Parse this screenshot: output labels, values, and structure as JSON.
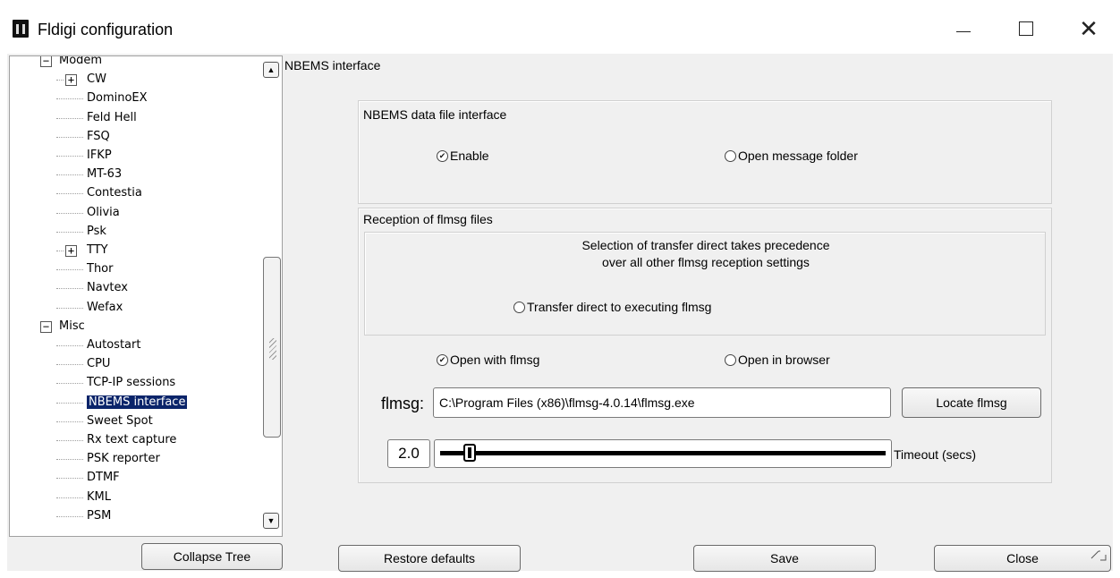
{
  "window": {
    "title": "Fldigi configuration",
    "controls": {
      "minimize": "minimize-icon",
      "maximize": "maximize-icon",
      "close": "close-icon"
    }
  },
  "tree": {
    "items": [
      {
        "label": "Modem",
        "toggle": "−"
      },
      {
        "label": "CW",
        "toggle": "+"
      },
      {
        "label": "DominoEX"
      },
      {
        "label": "Feld Hell"
      },
      {
        "label": "FSQ"
      },
      {
        "label": "IFKP"
      },
      {
        "label": "MT-63"
      },
      {
        "label": "Contestia"
      },
      {
        "label": "Olivia"
      },
      {
        "label": "Psk"
      },
      {
        "label": "TTY",
        "toggle": "+"
      },
      {
        "label": "Thor"
      },
      {
        "label": "Navtex"
      },
      {
        "label": "Wefax"
      },
      {
        "label": "Misc",
        "toggle": "−"
      },
      {
        "label": "Autostart"
      },
      {
        "label": "CPU"
      },
      {
        "label": "TCP-IP sessions"
      },
      {
        "label": "NBEMS interface",
        "selected": true
      },
      {
        "label": "Sweet Spot"
      },
      {
        "label": "Rx text capture"
      },
      {
        "label": "PSK reporter"
      },
      {
        "label": "DTMF"
      },
      {
        "label": "KML"
      },
      {
        "label": "PSM"
      }
    ],
    "scroll_up_icon": "▲",
    "scroll_down_icon": "▼"
  },
  "panel": {
    "title": "NBEMS interface",
    "data_file": {
      "label": "NBEMS data file interface",
      "enable": {
        "label": "Enable",
        "checked": true
      },
      "open_folder": {
        "label": "Open message folder",
        "checked": false
      }
    },
    "reception": {
      "label": "Reception of flmsg files",
      "note_line1": "Selection of transfer direct takes precedence",
      "note_line2": "over all other flmsg reception settings",
      "transfer_direct": {
        "label": "Transfer direct to executing flmsg",
        "checked": false
      },
      "open_with": {
        "label": "Open with flmsg",
        "checked": true
      },
      "open_browser": {
        "label": "Open in browser",
        "checked": false
      },
      "flmsg_label": "flmsg:",
      "flmsg_path": "C:\\Program Files (x86)\\flmsg-4.0.14\\flmsg.exe",
      "locate_button": "Locate flmsg",
      "timeout_value": "2.0",
      "timeout_label": "Timeout (secs)",
      "timeout_fraction": 0.05
    }
  },
  "footer": {
    "collapse": "Collapse Tree",
    "restore": "Restore defaults",
    "save": "Save",
    "close": "Close"
  }
}
